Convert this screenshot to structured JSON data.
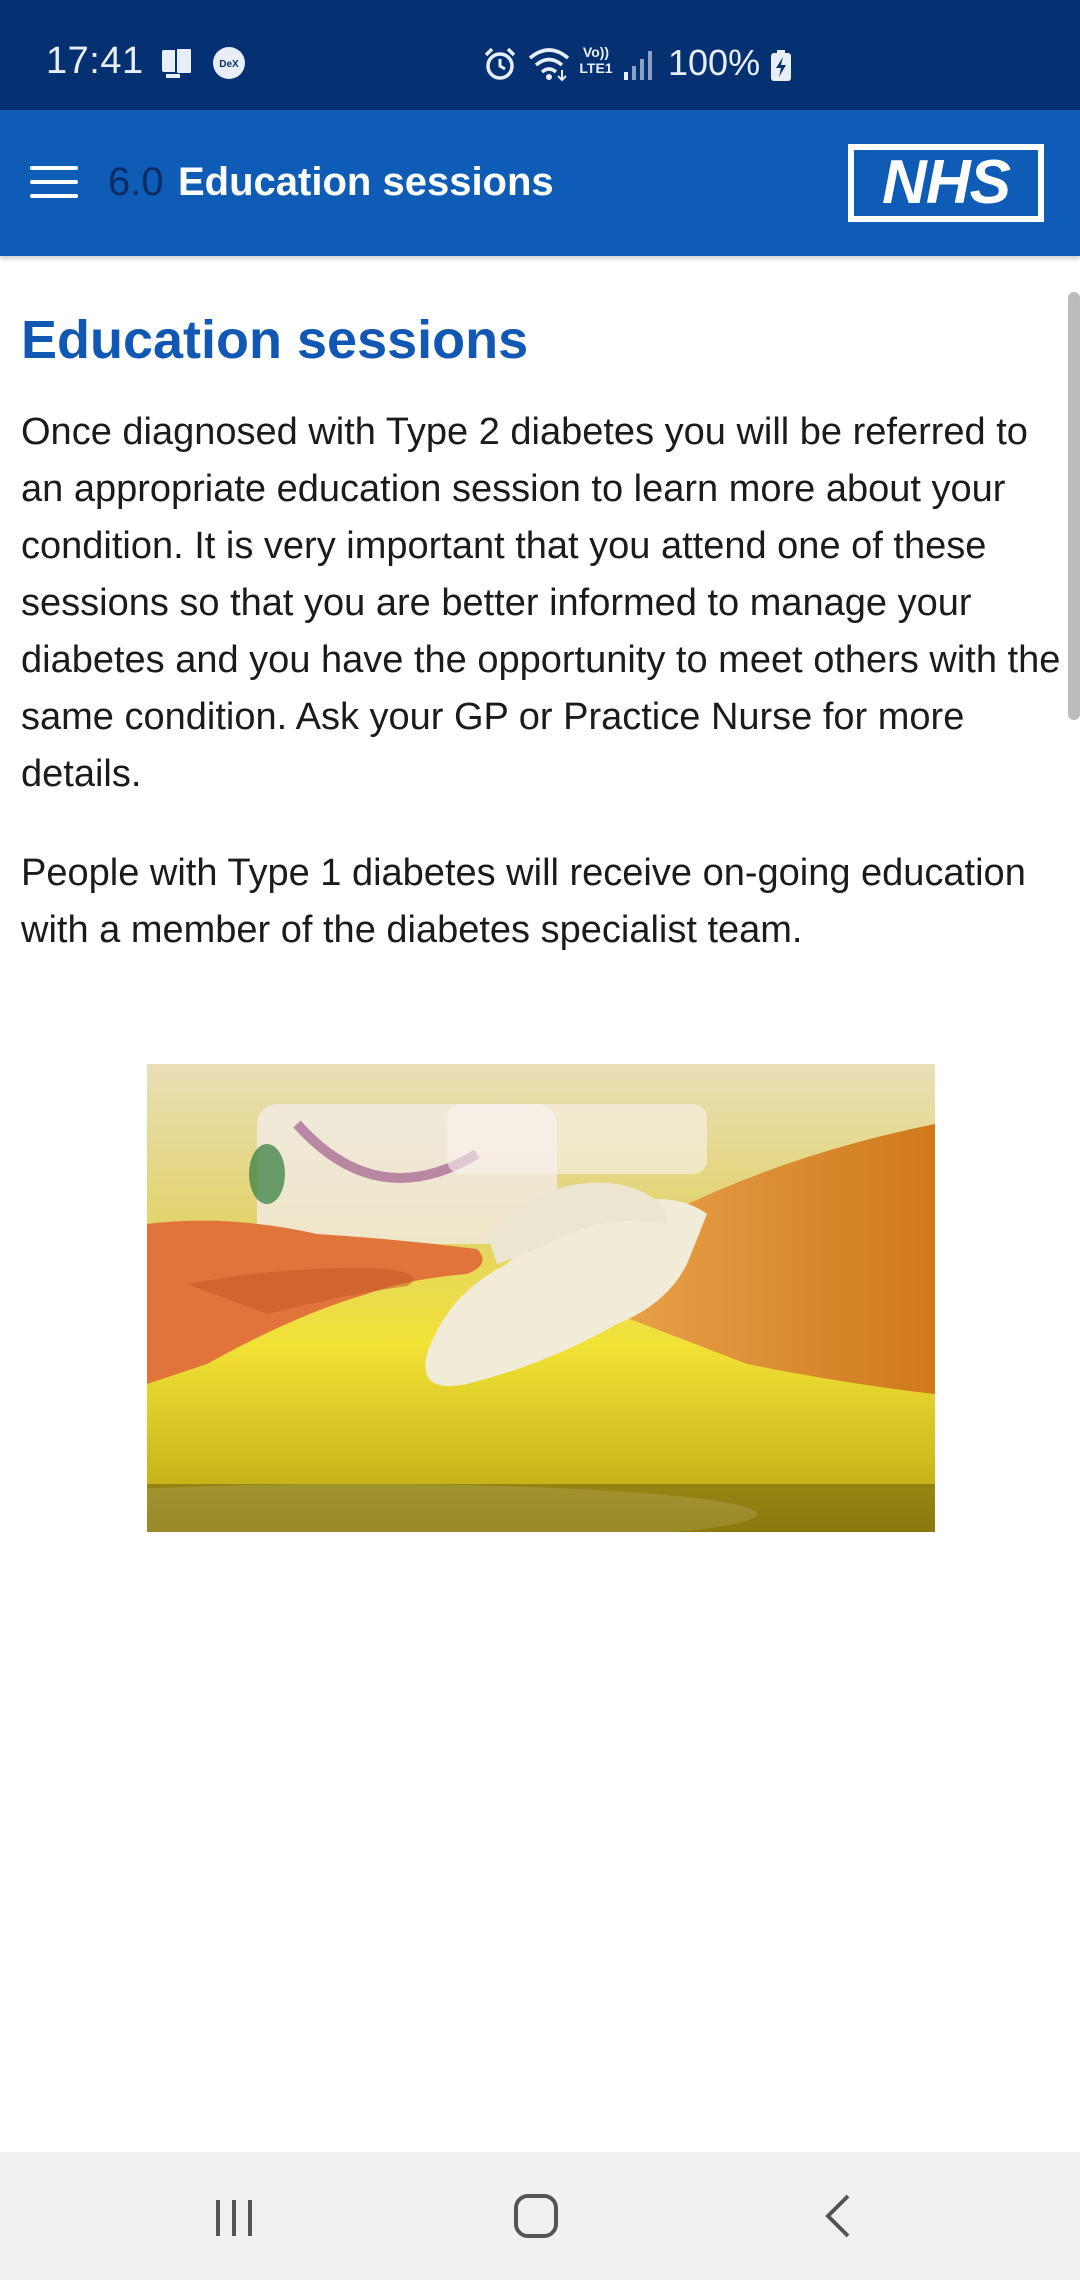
{
  "status_bar": {
    "time": "17:41",
    "battery_text": "100%",
    "icons": [
      "screen-mirror-icon",
      "dex-icon",
      "alarm-icon",
      "wifi-icon",
      "volte-lte-icon",
      "signal-icon",
      "battery-charging-icon"
    ],
    "volte_label": "Vo)) LTE1",
    "dex_label": "DeX"
  },
  "app_bar": {
    "section_number": "6.0",
    "title": "Education sessions",
    "logo_text": "NHS",
    "menu_icon": "menu-icon",
    "colors": {
      "bar": "#0e5cb5",
      "status": "#053172"
    }
  },
  "content": {
    "heading": "Education sessions",
    "paragraphs": [
      "Once diagnosed with Type 2 diabetes you will be referred to an appropriate education session to learn more about your condition. It is very important that you attend one of these sessions so that you are better informed to manage your diabetes and you have the opportunity to meet others with the same condition. Ask your GP or Practice Nurse for more details.",
      "People with Type 1 diabetes will receive on-going education with a member of the diabetes specialist team."
    ],
    "heading_color": "#1058b3"
  },
  "nav_bar": {
    "buttons": [
      "recent-apps-icon",
      "home-icon",
      "back-icon"
    ]
  }
}
